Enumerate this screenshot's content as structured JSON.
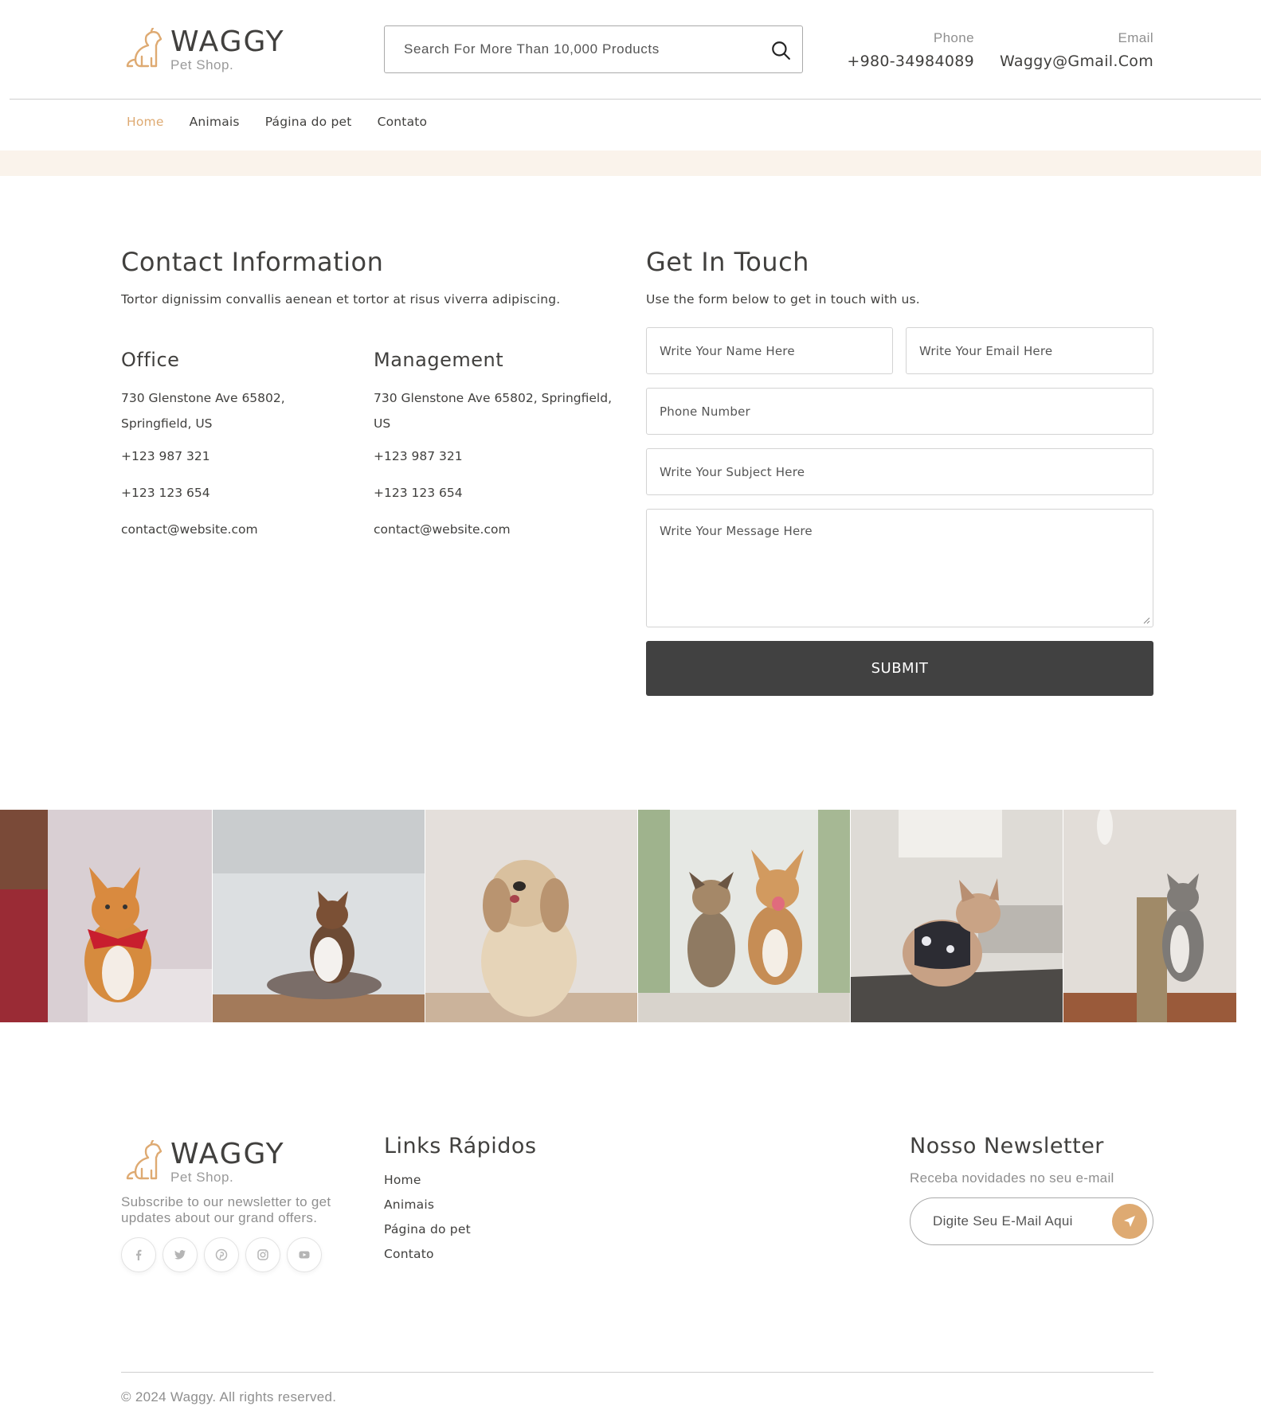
{
  "brand": {
    "name": "WAGGY",
    "tagline": "Pet Shop."
  },
  "search": {
    "placeholder": "Search For More Than 10,000 Products"
  },
  "header_contact": {
    "phone_label": "Phone",
    "phone_value": "+980-34984089",
    "email_label": "Email",
    "email_value": "Waggy@Gmail.Com"
  },
  "nav": {
    "items": [
      {
        "label": "Home",
        "active": true
      },
      {
        "label": "Animais",
        "active": false
      },
      {
        "label": "Página do pet",
        "active": false
      },
      {
        "label": "Contato",
        "active": false
      }
    ]
  },
  "contact_info": {
    "title": "Contact Information",
    "lead": "Tortor dignissim convallis aenean et tortor at risus viverra adipiscing.",
    "office": {
      "title": "Office",
      "address": "730 Glenstone Ave 65802, Springfield, US",
      "phone1": "+123 987 321",
      "phone2": "+123 123 654",
      "email": "contact@website.com"
    },
    "management": {
      "title": "Management",
      "address": "730 Glenstone Ave 65802, Springfield, US",
      "phone1": "+123 987 321",
      "phone2": "+123 123 654",
      "email": "contact@website.com"
    }
  },
  "form": {
    "title": "Get In Touch",
    "lead": "Use the form below to get in touch with us.",
    "name_placeholder": "Write Your Name Here",
    "email_placeholder": "Write Your Email Here",
    "phone_placeholder": "Phone Number",
    "subject_placeholder": "Write Your Subject Here",
    "message_placeholder": "Write Your Message Here",
    "submit_label": "SUBMIT"
  },
  "gallery": [
    "cat-with-red-bandana",
    "cat-on-pet-bed",
    "fluffy-dog",
    "two-dogs-running",
    "french-bulldog-in-harness",
    "kitten-on-scratching-post"
  ],
  "footer": {
    "description": "Subscribe to our newsletter to get updates about our grand offers.",
    "socials": [
      "facebook-icon",
      "twitter-icon",
      "pinterest-icon",
      "instagram-icon",
      "youtube-icon"
    ],
    "links_title": "Links Rápidos",
    "links": [
      "Home",
      "Animais",
      "Página do pet",
      "Contato"
    ],
    "newsletter_title": "Nosso Newsletter",
    "newsletter_sub": "Receba novidades no seu e-mail",
    "newsletter_placeholder": "Digite Seu E-Mail Aqui",
    "copyright": "© 2024 Waggy. All rights reserved."
  },
  "colors": {
    "accent": "#deaa72",
    "text": "#41403e",
    "muted": "#8f8f8f",
    "button_dark": "#414141",
    "strip": "#faf3eb"
  }
}
